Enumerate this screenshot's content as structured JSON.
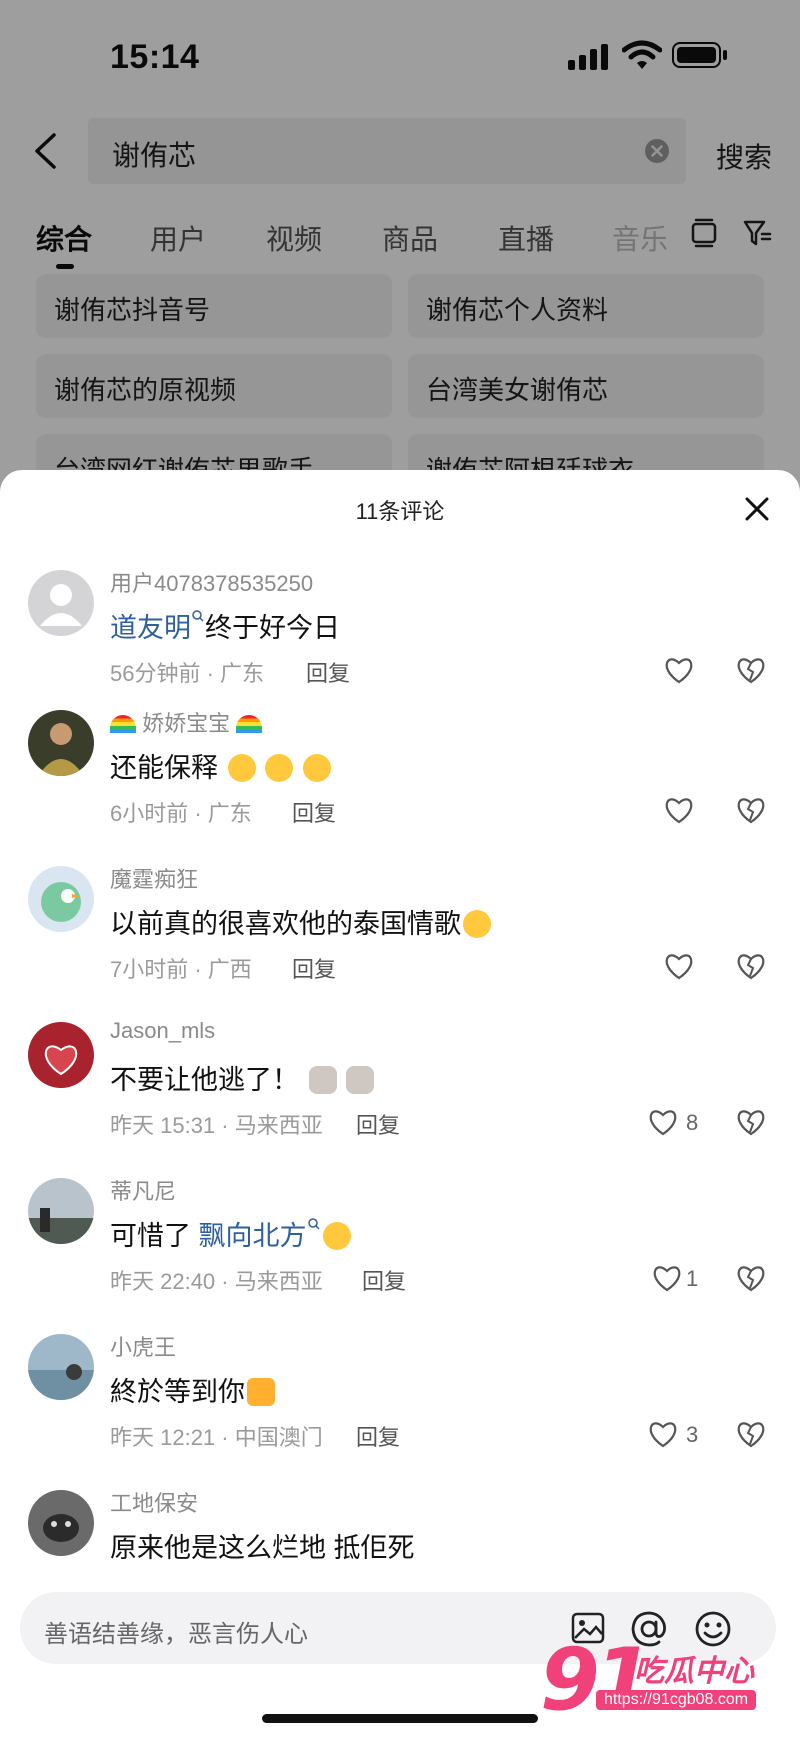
{
  "status_bar": {
    "time": "15:14"
  },
  "search": {
    "query": "谢侑芯",
    "button": "搜索"
  },
  "tabs": [
    {
      "label": "综合"
    },
    {
      "label": "用户"
    },
    {
      "label": "视频"
    },
    {
      "label": "商品"
    },
    {
      "label": "直播"
    },
    {
      "label": "音乐"
    }
  ],
  "suggestions": [
    "谢侑芯抖音号",
    "谢侑芯个人资料",
    "谢侑芯的原视频",
    "台湾美女谢侑芯",
    "台湾网红谢侑芯男歌手",
    "谢侑芯阿根廷球衣"
  ],
  "comments_sheet": {
    "title": "11条评论",
    "reply_label": "回复",
    "comments": [
      {
        "user": "用户4078378535250",
        "mention": "道友明",
        "text": "终于好今日",
        "time_loc": "56分钟前 · 广东",
        "likes": "",
        "avatar_icon": "default-avatar"
      },
      {
        "user": "娇娇宝宝",
        "user_emoji": "rainbow",
        "mention": "",
        "text": "还能保释",
        "text_emoji": "crying-face x3",
        "time_loc": "6小时前 · 广东",
        "likes": ""
      },
      {
        "user": "魔霆痴狂",
        "mention": "",
        "text": "以前真的很喜欢他的泰国情歌",
        "text_emoji": "loud-crying-face",
        "time_loc": "7小时前 · 广西",
        "likes": ""
      },
      {
        "user": "Jason_mls",
        "mention": "",
        "text": "不要让他逃了！",
        "text_emoji": "cat-face x2",
        "time_loc": "昨天 15:31 · 马来西亚",
        "likes": "8"
      },
      {
        "user": "蒂凡尼",
        "mention": "飘向北方",
        "text": "可惜了 ",
        "text_emoji": "tears-of-joy",
        "time_loc": "昨天 22:40 · 马来西亚",
        "likes": "1"
      },
      {
        "user": "小虎王",
        "mention": "",
        "text": "終於等到你",
        "text_emoji": "thumbs-up",
        "time_loc": "昨天 12:21 · 中国澳门",
        "likes": "3"
      },
      {
        "user": "工地保安",
        "mention": "",
        "text": "原来他是这么烂地 抵佢死",
        "time_loc": "",
        "likes": ""
      }
    ]
  },
  "input": {
    "placeholder": "善语结善缘，恶言伤人心"
  },
  "watermark": {
    "brand": "91",
    "text": "吃瓜中心",
    "url": "https://91cgb08.com"
  },
  "colors": {
    "mention": "#2f5f9e",
    "watermark": "#f0417a"
  }
}
